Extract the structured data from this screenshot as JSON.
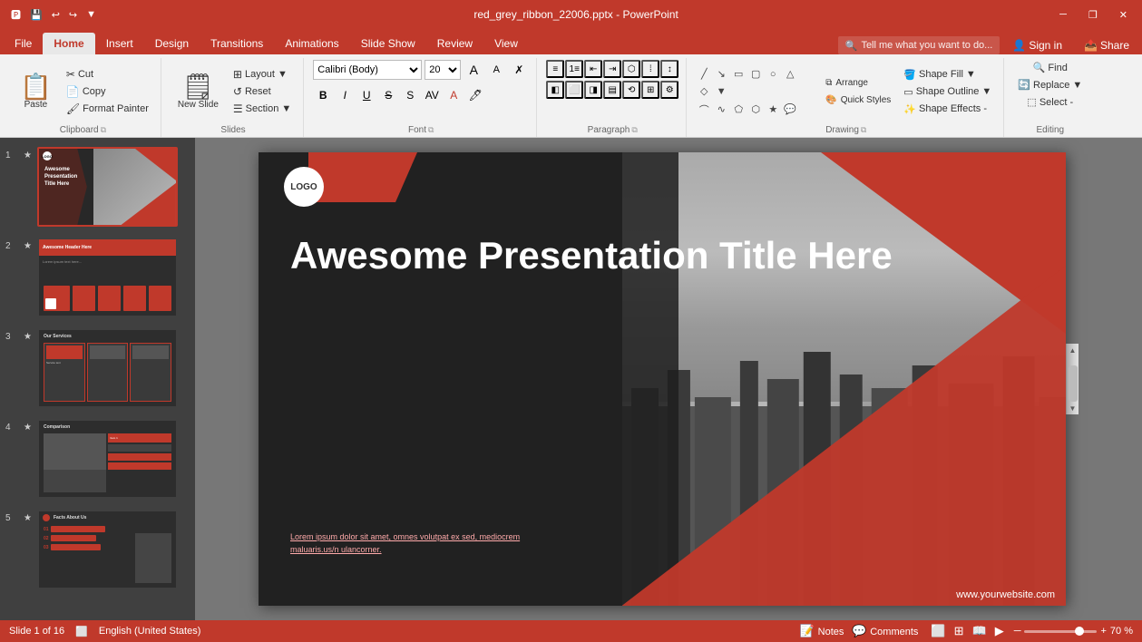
{
  "titlebar": {
    "filename": "red_grey_ribbon_22006.pptx - PowerPoint",
    "quickaccess": [
      "save",
      "undo",
      "redo",
      "customize"
    ]
  },
  "tabs": {
    "items": [
      "File",
      "Home",
      "Insert",
      "Design",
      "Transitions",
      "Animations",
      "Slide Show",
      "Review",
      "View"
    ],
    "active": "Home",
    "right": [
      "Tell me what you want to do...",
      "Sign in",
      "Share"
    ]
  },
  "ribbon": {
    "groups": {
      "clipboard": {
        "label": "Clipboard",
        "paste": "Paste",
        "cut": "Cut",
        "copy": "Copy",
        "format_painter": "Format Painter"
      },
      "slides": {
        "label": "Slides",
        "new_slide": "New Slide",
        "layout": "Layout",
        "reset": "Reset",
        "section": "Section"
      },
      "font": {
        "label": "Font",
        "font_name": "Calibri (Body)",
        "font_size": "20",
        "bold": "B",
        "italic": "I",
        "underline": "U",
        "strikethrough": "S",
        "shadow": "S"
      },
      "paragraph": {
        "label": "Paragraph"
      },
      "drawing": {
        "label": "Drawing",
        "arrange": "Arrange",
        "quick_styles": "Quick Styles",
        "shape_fill": "Shape Fill",
        "shape_outline": "Shape Outline",
        "shape_effects": "Shape Effects -"
      },
      "editing": {
        "label": "Editing",
        "find": "Find",
        "replace": "Replace",
        "select": "Select -"
      }
    }
  },
  "slides": [
    {
      "num": "1",
      "title": "Awesome Presentation Title Here",
      "selected": true
    },
    {
      "num": "2",
      "title": "Awesome Header Here"
    },
    {
      "num": "3",
      "title": "Our Services"
    },
    {
      "num": "4",
      "title": "Comparison"
    },
    {
      "num": "5",
      "title": "Facts About Us"
    }
  ],
  "canvas": {
    "logo": "LOGO",
    "title": "Awesome Presentation Title Here",
    "subtitle": "Lorem ipsum dolor sit amet, omnes volutpat ex sed, mediocrem\nmaluaris.us/n ulancorner.",
    "website": "www.yourwebsite.com"
  },
  "statusbar": {
    "slide_info": "Slide 1 of 16",
    "spell_check": "🔍",
    "language": "English (United States)",
    "notes": "Notes",
    "comments": "Comments",
    "zoom": "70 %",
    "zoom_level": 70
  }
}
